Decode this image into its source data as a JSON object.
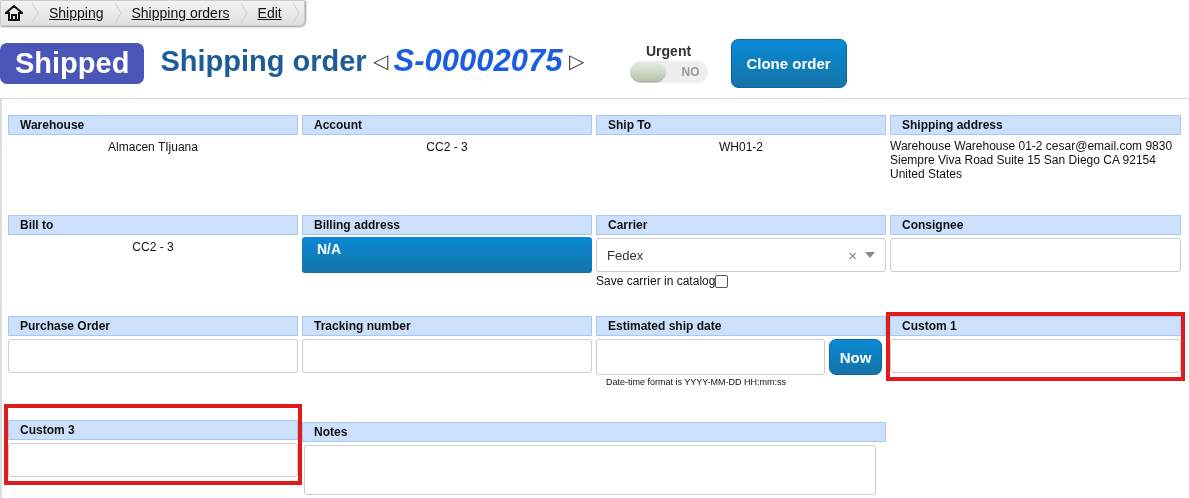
{
  "breadcrumb": [
    "Shipping",
    "Shipping orders",
    "Edit"
  ],
  "status": "Shipped",
  "title": "Shipping order",
  "order_number": "S-00002075",
  "prev": "◁",
  "next": "▷",
  "urgent": {
    "label": "Urgent",
    "on": false,
    "state_text": "NO"
  },
  "clone_button": "Clone order",
  "rows": [
    [
      {
        "kind": "text",
        "label": "Warehouse",
        "value": "Almacen TIjuana",
        "highlighted": false
      },
      {
        "kind": "text",
        "label": "Account",
        "value": "CC2 - 3",
        "highlighted": false
      },
      {
        "kind": "text",
        "label": "Ship To",
        "value": "WH01-2",
        "highlighted": false
      },
      {
        "kind": "address",
        "label": "Shipping address",
        "value": "Warehouse Warehouse 01-2 cesar@email.com 9830 Siempre Viva Road Suite 15 San Diego CA 92154 United States",
        "highlighted": false
      }
    ],
    [
      {
        "kind": "text",
        "label": "Bill to",
        "value": "CC2 - 3",
        "highlighted": false
      },
      {
        "kind": "button",
        "label": "Billing address",
        "value": "N/A",
        "highlighted": false
      },
      {
        "kind": "select",
        "label": "Carrier",
        "value": "Fedex",
        "clear": "×",
        "checkbox_label": "Save carrier in catalog",
        "checked": false,
        "highlighted": false
      },
      {
        "kind": "input",
        "label": "Consignee",
        "highlighted": false
      }
    ],
    [
      {
        "kind": "input",
        "label": "Purchase Order",
        "highlighted": false
      },
      {
        "kind": "input",
        "label": "Tracking number",
        "highlighted": false
      },
      {
        "kind": "date",
        "label": "Estimated ship date",
        "button": "Now",
        "hint": "Date-time format is YYYY-MM-DD HH:mm:ss",
        "highlighted": false
      },
      {
        "kind": "input",
        "label": "Custom 1",
        "highlighted": true
      }
    ],
    [
      {
        "kind": "input",
        "label": "Custom 3",
        "highlighted": true
      },
      {
        "kind": "textarea",
        "label": "Notes",
        "highlighted": false
      }
    ]
  ]
}
